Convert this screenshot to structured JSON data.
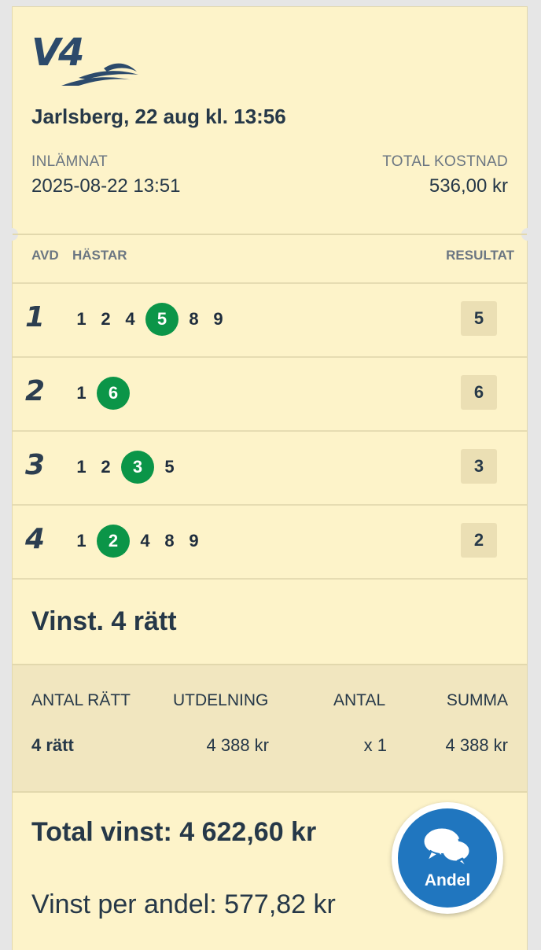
{
  "logo": {
    "text": "V4"
  },
  "race": {
    "title": "Jarlsberg, 22 aug kl. 13:56"
  },
  "submitted": {
    "label": "INLÄMNAT",
    "value": "2025-08-22 13:51"
  },
  "cost": {
    "label": "TOTAL KOSTNAD",
    "value": "536,00 kr"
  },
  "columns": {
    "avd": "AVD",
    "horses": "HÄSTAR",
    "result": "RESULTAT"
  },
  "legs": [
    {
      "num": "1",
      "horses": [
        "1",
        "2",
        "4",
        "5",
        "8",
        "9"
      ],
      "winner": "5",
      "result": "5"
    },
    {
      "num": "2",
      "horses": [
        "1",
        "6"
      ],
      "winner": "6",
      "result": "6"
    },
    {
      "num": "3",
      "horses": [
        "1",
        "2",
        "3",
        "5"
      ],
      "winner": "3",
      "result": "3"
    },
    {
      "num": "4",
      "horses": [
        "1",
        "2",
        "4",
        "8",
        "9"
      ],
      "winner": "2",
      "result": "2"
    }
  ],
  "win": {
    "title": "Vinst. 4 rätt",
    "headers": {
      "correct": "ANTAL RÄTT",
      "payout": "UTDELNING",
      "count": "ANTAL",
      "sum": "SUMMA"
    },
    "row": {
      "correct": "4 rätt",
      "payout": "4 388 kr",
      "count": "x 1",
      "sum": "4 388 kr"
    }
  },
  "total_win": "Total vinst: 4 622,60 kr",
  "per_share": "Vinst per andel: 577,82 kr",
  "fab": {
    "label": "Andel",
    "icon": "chat-bubbles-icon",
    "color": "#2076bf"
  },
  "colors": {
    "winner": "#0b9548",
    "ticket_bg": "#fdf3c9",
    "text": "#263848"
  }
}
